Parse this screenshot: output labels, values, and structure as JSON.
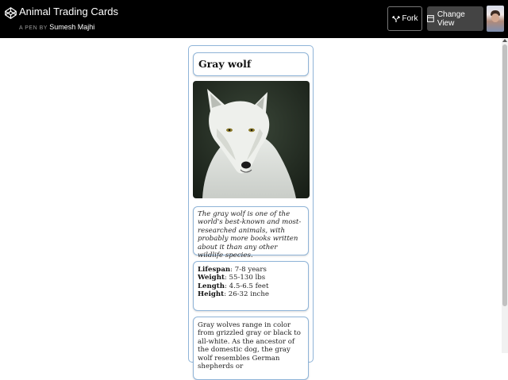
{
  "header": {
    "title": "Animal Trading Cards",
    "byline_prefix": "A PEN BY",
    "author": "Sumesh Majhi",
    "fork_label": "Fork",
    "change_view_label": "Change View"
  },
  "card": {
    "name": "Gray wolf",
    "description": "The gray wolf is one of the world's best-known and most-researched animals, with probably more books written about it than any other wildlife species.",
    "stats": [
      {
        "label": "Lifespan",
        "value": ": 7-8 years"
      },
      {
        "label": "Weight",
        "value": ": 55-130 lbs"
      },
      {
        "label": "Length",
        "value": ": 4.5-6.5 feet"
      },
      {
        "label": "Height",
        "value": ": 26-32 inche"
      }
    ],
    "more_info": "Gray wolves range in color from grizzled gray or black to all-white. As the ancestor of the domestic dog, the gray wolf resembles German shepherds or"
  }
}
